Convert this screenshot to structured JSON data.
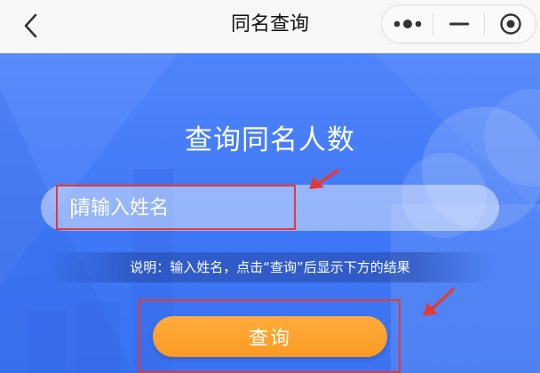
{
  "nav": {
    "title": "同名查询",
    "icons": {
      "back": "chevron-left-icon",
      "more": "more-dots-icon",
      "minimize": "minimize-icon",
      "close": "target-close-icon"
    }
  },
  "main": {
    "headline": "查询同名人数",
    "name_input": {
      "placeholder": "请输入姓名",
      "value": ""
    },
    "hint": "说明：输入姓名，点击“查询”后显示下方的结果",
    "query_button": "查询"
  },
  "colors": {
    "background_blue": "#4f84fb",
    "button_orange": "#fb9a23",
    "annotation_red": "#e53935"
  }
}
